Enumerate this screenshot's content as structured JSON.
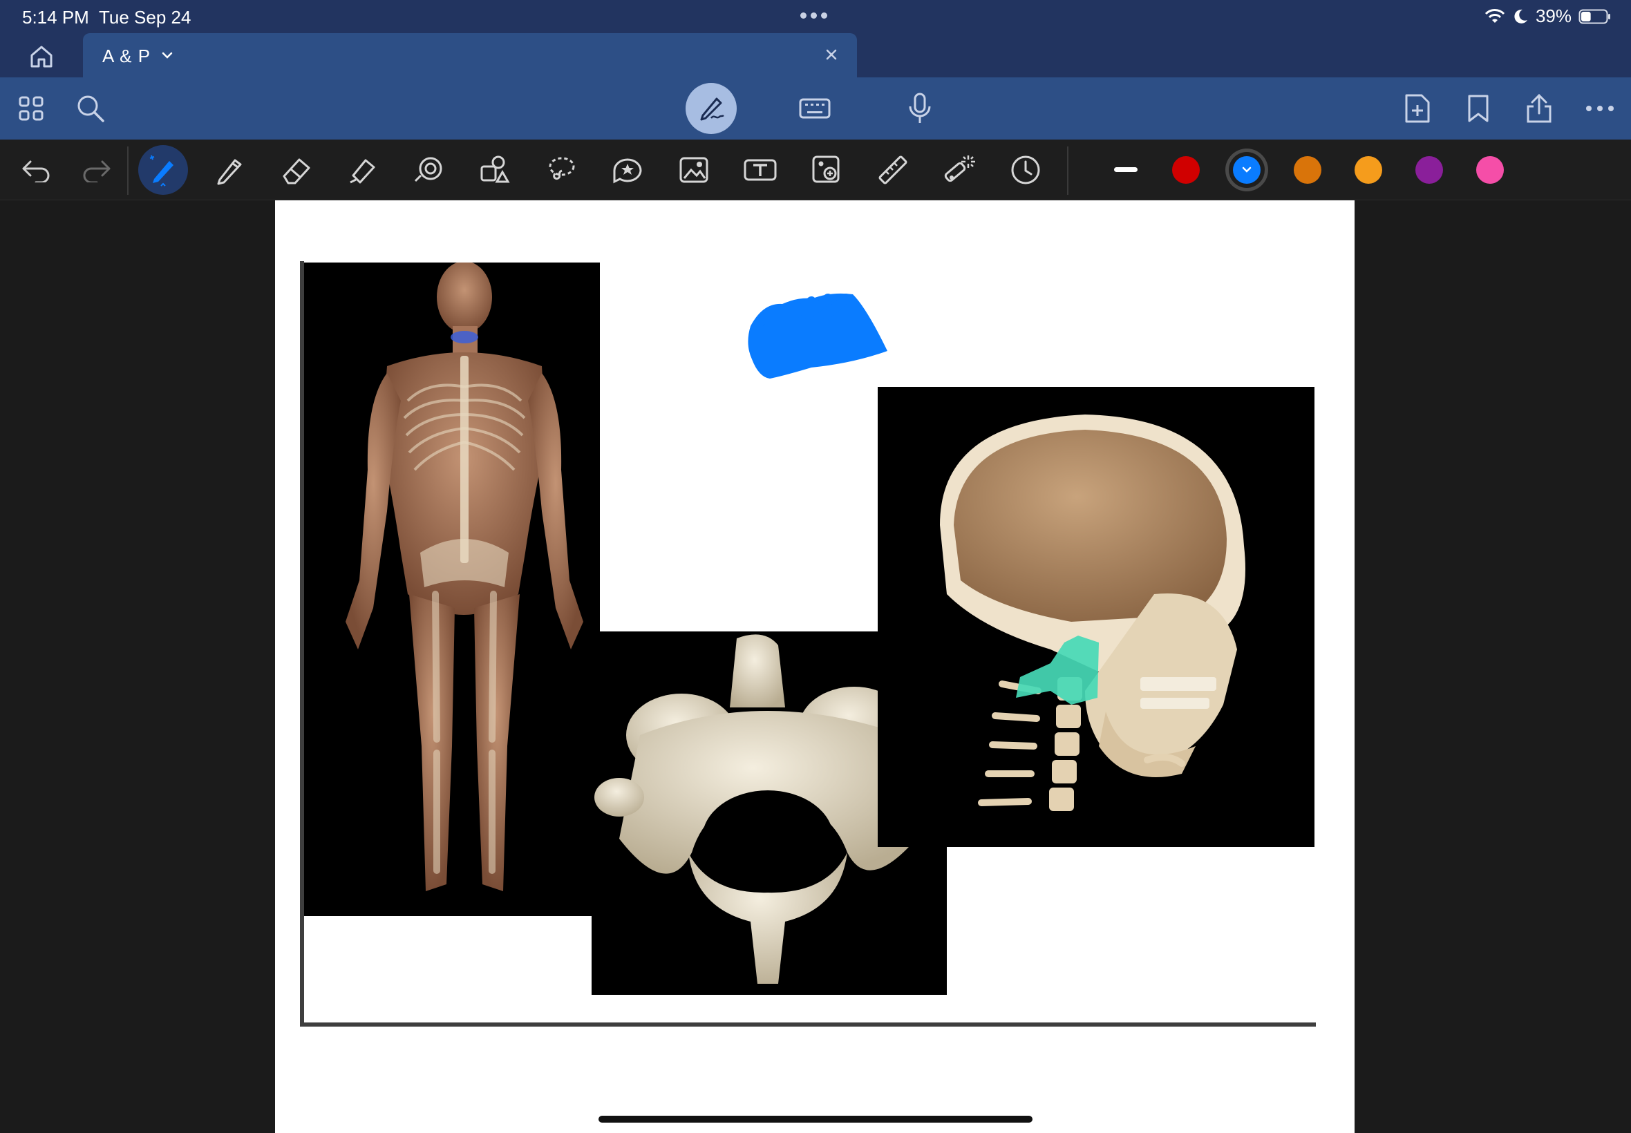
{
  "status_bar": {
    "time": "5:14 PM",
    "date": "Tue Sep 24",
    "battery_percent": "39%",
    "battery_level": 0.39
  },
  "tab_bar": {
    "document_title": "A & P"
  },
  "colors": {
    "status_bg": "#223460",
    "toolbar_bg": "#2d4f86",
    "toolbar_active": "#a7bde2",
    "toolbar2_bg": "#1e1e1e",
    "ink_blue": "#0a7cff",
    "teal_highlight": "#46d9b6"
  },
  "main_toolbar": {
    "left_icons": [
      "grid-icon",
      "search-icon"
    ],
    "mode_icons": [
      "pen-mode-icon",
      "keyboard-icon",
      "microphone-icon"
    ],
    "active_mode": "pen-mode-icon",
    "right_icons": [
      "add-page-icon",
      "bookmark-icon",
      "share-icon",
      "more-icon"
    ]
  },
  "tool_bar": {
    "history": [
      "undo-icon",
      "redo-icon"
    ],
    "tools": [
      "fountain-pen-icon",
      "pencil-icon",
      "eraser-icon",
      "highlighter-icon",
      "shape-icon",
      "elements-icon",
      "lasso-icon",
      "sticker-icon",
      "image-icon",
      "text-icon",
      "camera-icon",
      "ruler-icon",
      "laser-pointer-icon",
      "history-icon"
    ],
    "active_tool": "fountain-pen-icon",
    "swatches": [
      {
        "name": "red",
        "color": "#d00000"
      },
      {
        "name": "blue",
        "color": "#0a7cff",
        "selected": true
      },
      {
        "name": "dark-orange",
        "color": "#d9740a"
      },
      {
        "name": "orange",
        "color": "#f59c1c"
      },
      {
        "name": "purple",
        "color": "#8a1f9a"
      },
      {
        "name": "pink",
        "color": "#f54ea8"
      }
    ]
  },
  "canvas": {
    "images": [
      "posterior-skeleton-image",
      "vertebra-image",
      "skull-sagittal-image"
    ],
    "annotations": [
      "blue-scribble"
    ]
  }
}
